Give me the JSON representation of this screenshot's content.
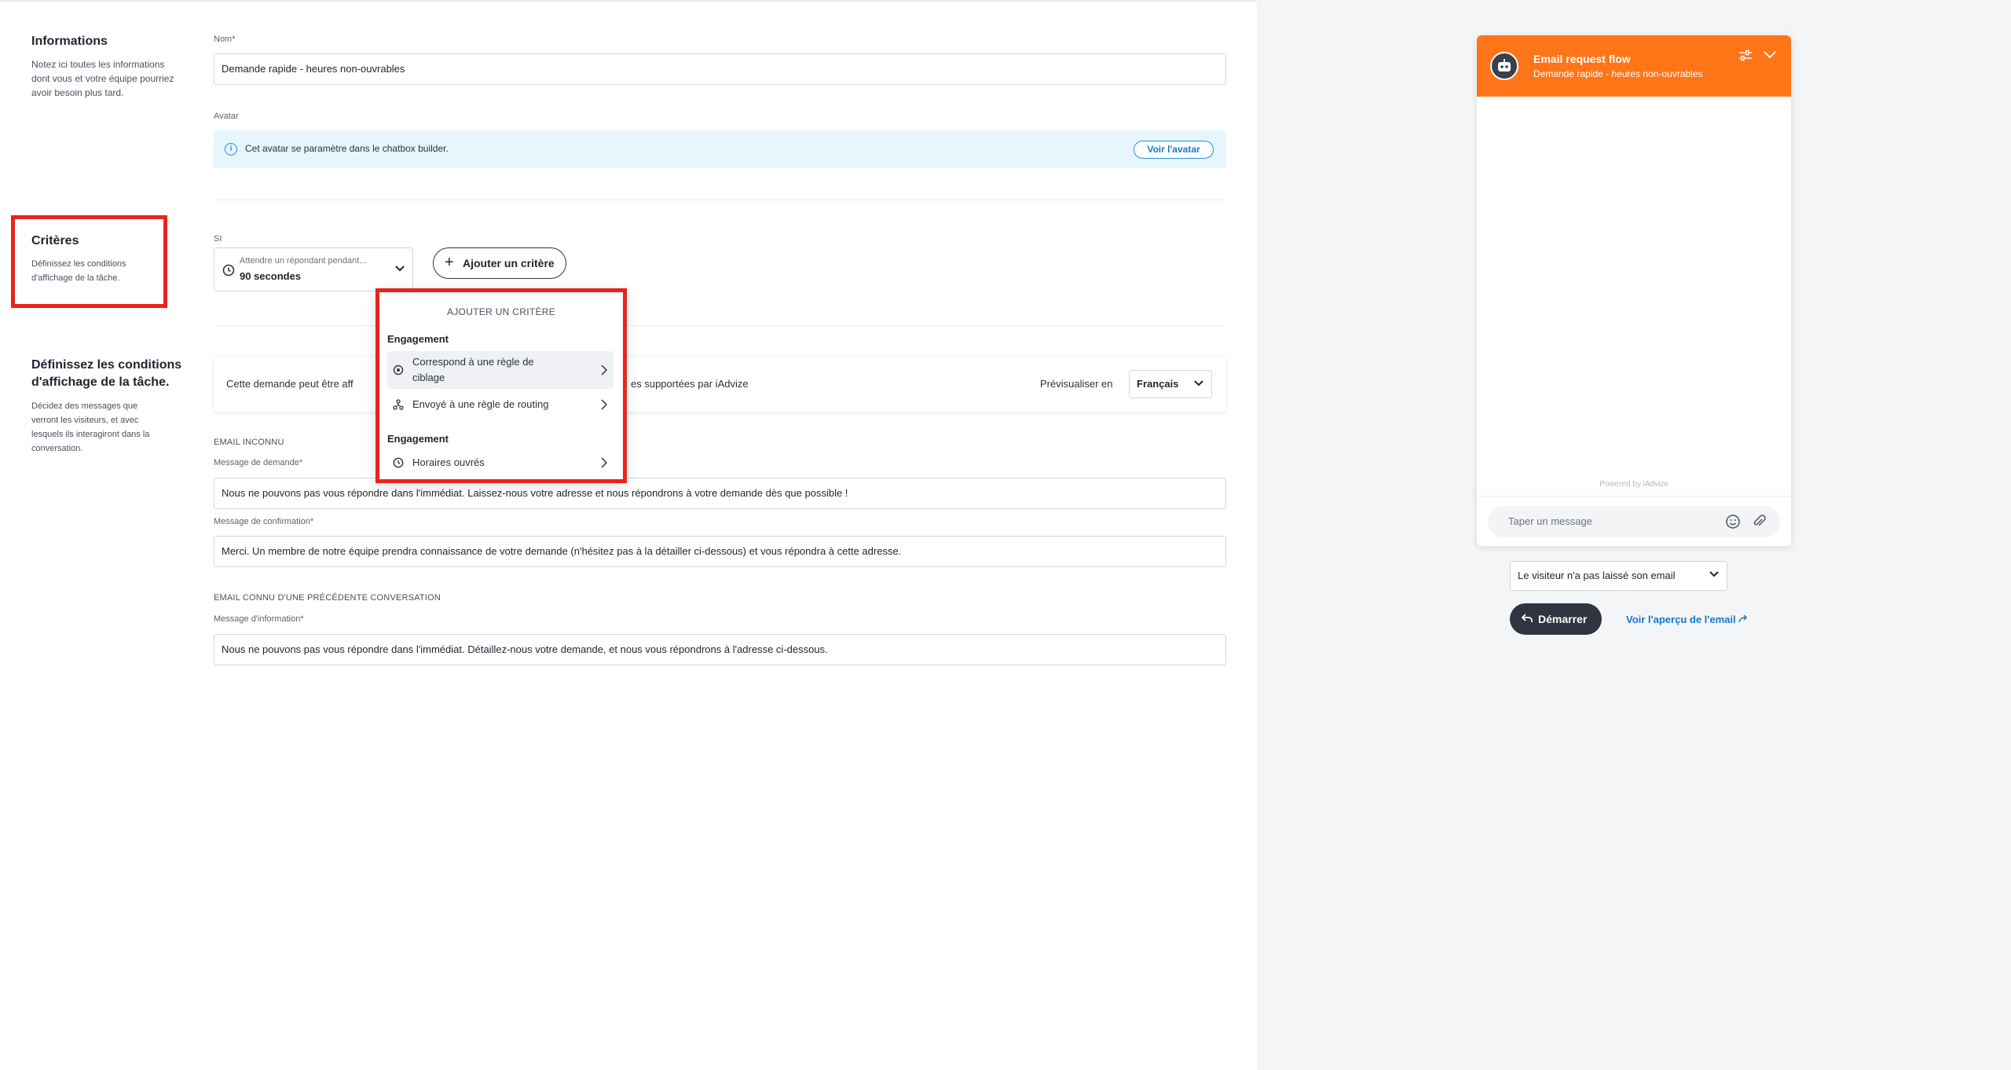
{
  "informations": {
    "title": "Informations",
    "description_lines": [
      "Notez ici toutes les informations",
      "dont vous et votre équipe pourriez",
      "avoir besoin plus tard."
    ],
    "name_label": "Nom*",
    "name_value": "Demande rapide - heures non-ouvrables",
    "avatar_label": "Avatar",
    "avatar_info": "Cet avatar se paramètre dans le chatbox builder.",
    "avatar_button": "Voir l'avatar"
  },
  "criteres": {
    "title": "Critères",
    "description_lines": [
      "Définissez les conditions",
      "d'affichage de la tâche."
    ],
    "si_label": "SI",
    "select_small": "Attendre un répondant pendant...",
    "select_value": "90 secondes",
    "add_button": "Ajouter un critère"
  },
  "dropdown": {
    "header": "AJOUTER UN CRITÈRE",
    "groups": [
      {
        "label": "Engagement",
        "items": [
          {
            "label_lines": [
              "Correspond à une règle de",
              "ciblage"
            ],
            "icon": "target-icon",
            "highlighted": true
          },
          {
            "label_lines": [
              "Envoyé à une règle de routing"
            ],
            "icon": "routing-icon",
            "highlighted": false
          }
        ]
      },
      {
        "label": "Engagement",
        "items": [
          {
            "label_lines": [
              "Horaires ouvrés"
            ],
            "icon": "clock-icon",
            "highlighted": false
          }
        ]
      }
    ]
  },
  "messages": {
    "title_lines": [
      "Définissez les conditions",
      "d'affichage de la tâche."
    ],
    "description_lines": [
      "Décidez des messages que",
      "verront les visiteurs, et avec",
      "lesquels ils interagiront dans la",
      "conversation."
    ],
    "preview_text_left": "Cette demande peut être aff",
    "preview_text_right": "es supportées par iAdvize",
    "preview_label": "Prévisualiser en",
    "preview_language": "Français",
    "unknown_section": "EMAIL INCONNU",
    "request_label": "Message de demande*",
    "request_value": "Nous ne pouvons pas vous répondre dans l'immédiat. Laissez-nous votre adresse et nous répondrons à votre demande dès que possible !",
    "confirmation_label": "Message de confirmation*",
    "confirmation_value": "Merci. Un membre de notre équipe prendra connaissance de votre demande (n'hésitez pas à la détailler ci-dessous) et vous répondra à cette adresse.",
    "known_section": "EMAIL CONNU D'UNE PRÉCÉDENTE CONVERSATION",
    "info_label": "Message d'information*",
    "info_value": "Nous ne pouvons pas vous répondre dans l'immédiat. Détaillez-nous votre demande, et nous vous répondrons à l'adresse ci-dessous."
  },
  "chat": {
    "title": "Email request flow",
    "subtitle": "Demande rapide - heures non-ouvrables",
    "powered_by": "Powered by",
    "powered_brand": "iAdvize",
    "input_placeholder": "Taper un message",
    "accent_color": "#ff7517"
  },
  "preview_controls": {
    "visitor_option": "Le visiteur n'a pas laissé son email",
    "start_button": "Démarrer",
    "email_preview_link": "Voir l'aperçu de l'email"
  }
}
